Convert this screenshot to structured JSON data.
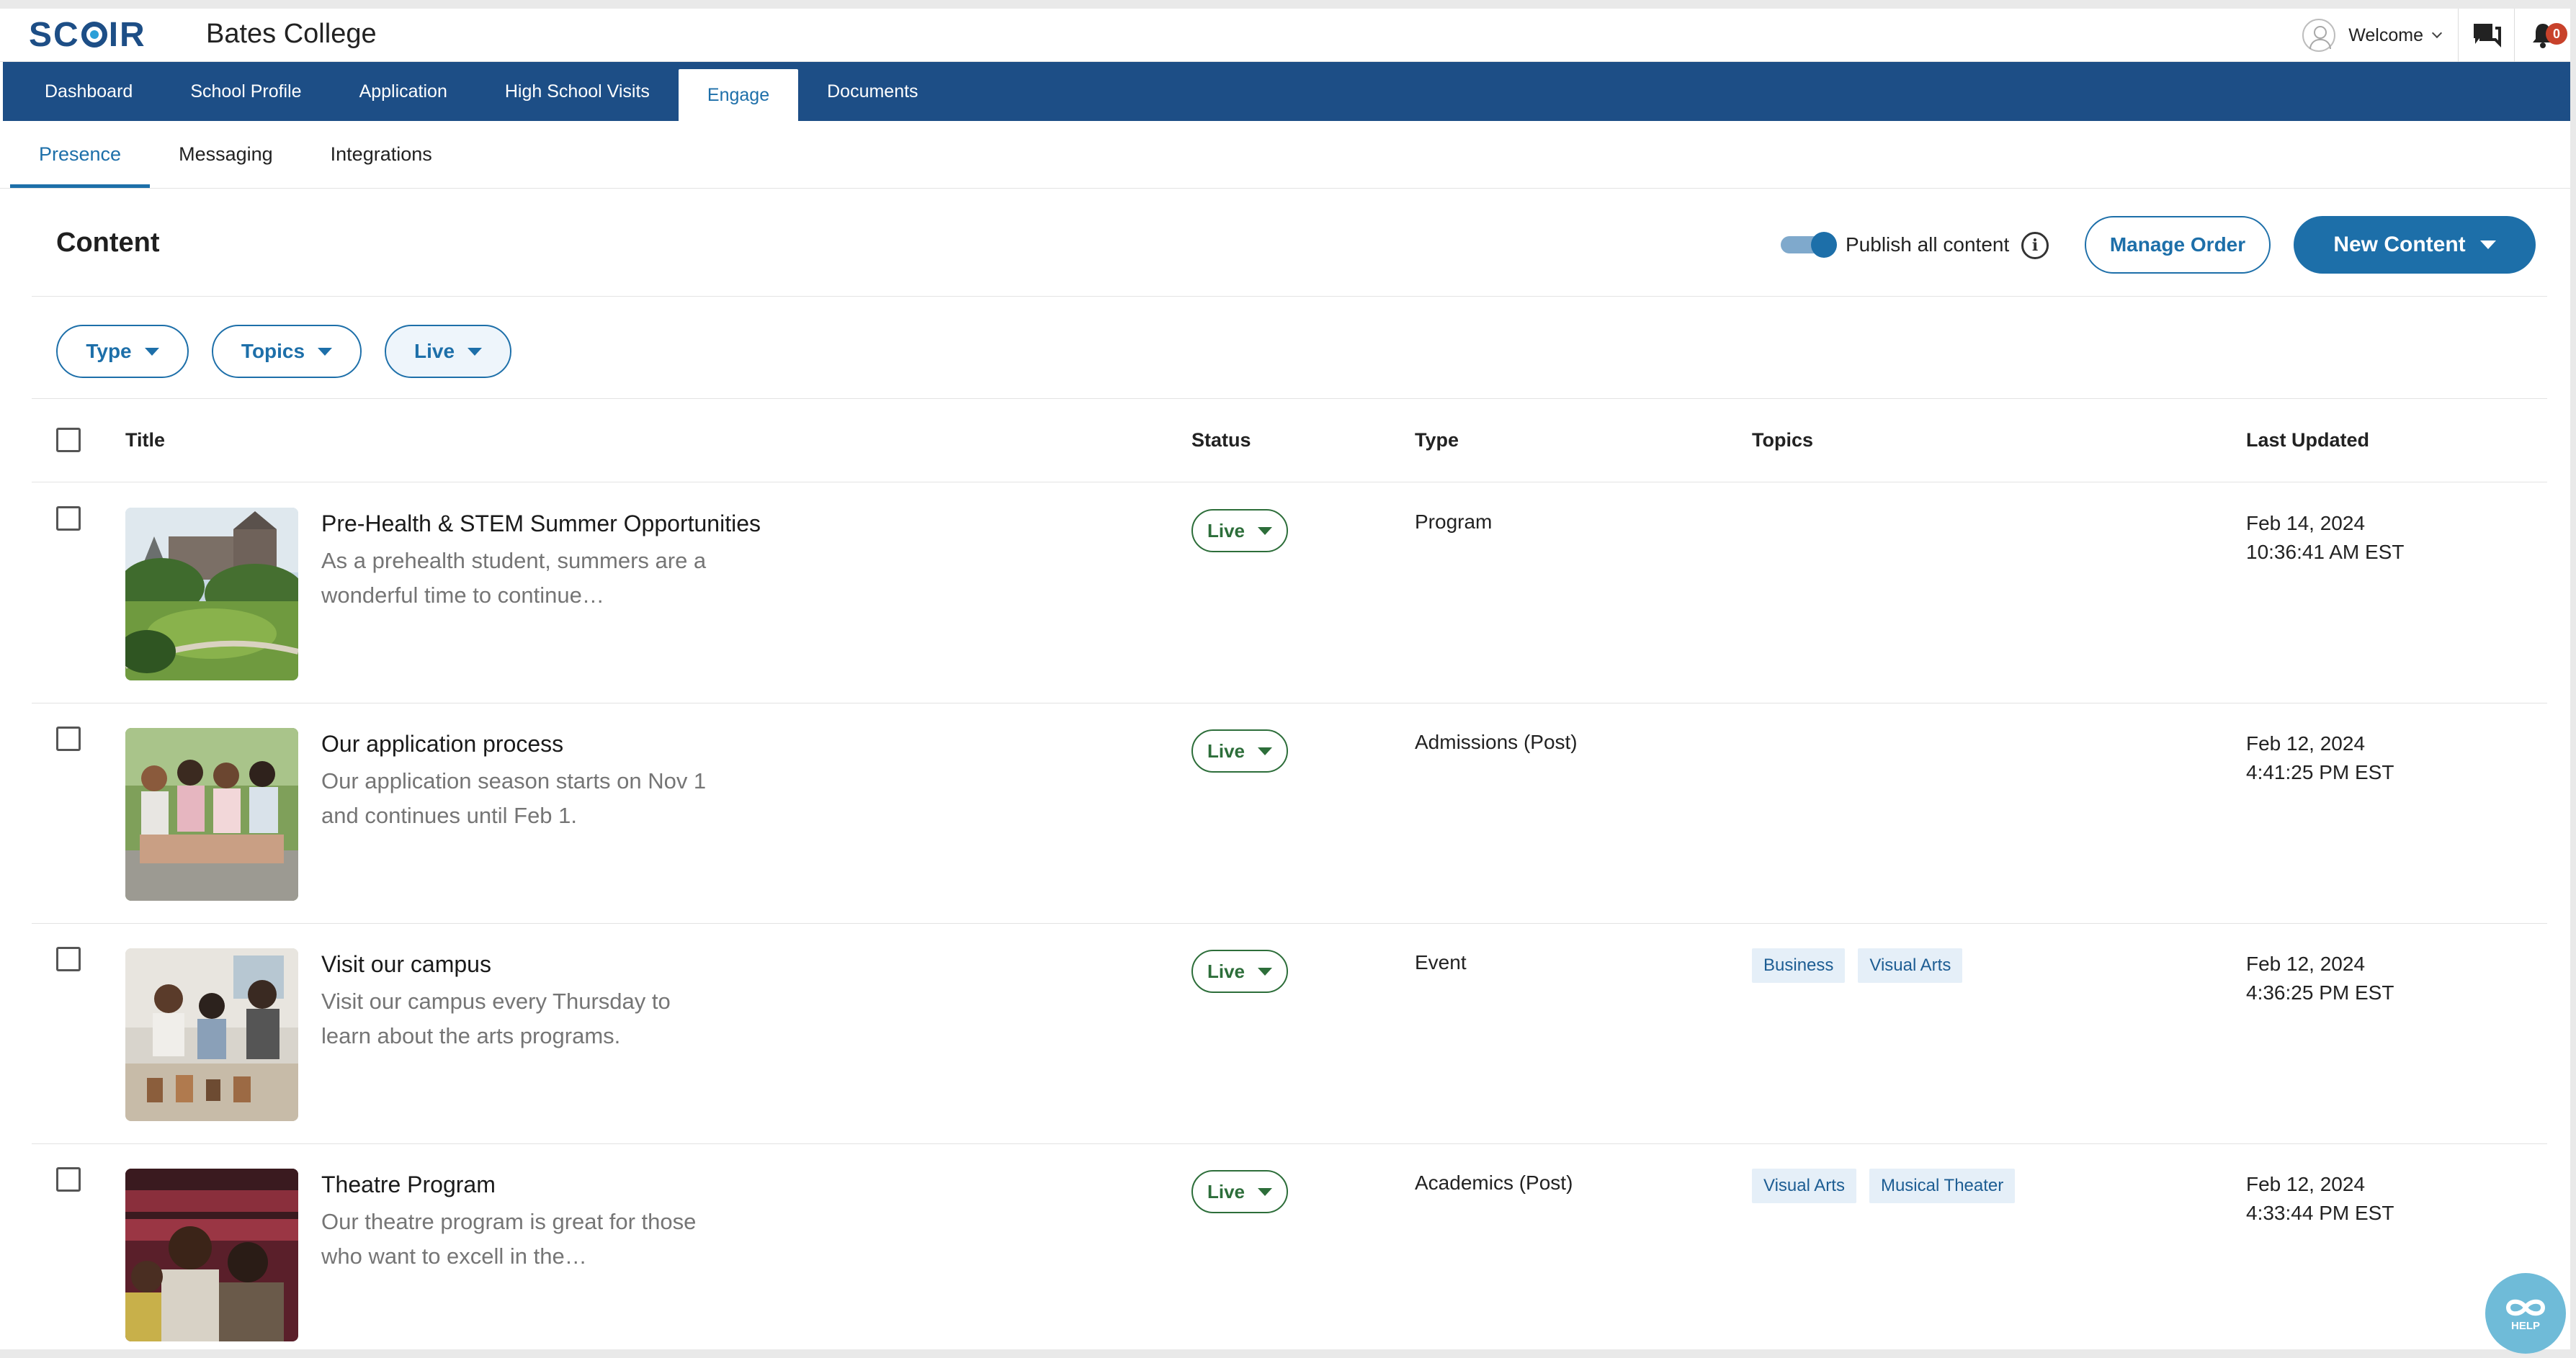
{
  "header": {
    "logo_text": "SCOIR",
    "college_name": "Bates College",
    "welcome_label": "Welcome",
    "notification_count": "0",
    "icons": [
      "avatar-icon",
      "chevron-down-icon",
      "chat-icon",
      "bell-icon"
    ]
  },
  "nav": {
    "items": [
      {
        "label": "Dashboard",
        "active": false
      },
      {
        "label": "School Profile",
        "active": false
      },
      {
        "label": "Application",
        "active": false
      },
      {
        "label": "High School Visits",
        "active": false
      },
      {
        "label": "Engage",
        "active": true
      },
      {
        "label": "Documents",
        "active": false
      }
    ]
  },
  "subnav": {
    "items": [
      {
        "label": "Presence",
        "active": true
      },
      {
        "label": "Messaging",
        "active": false
      },
      {
        "label": "Integrations",
        "active": false
      }
    ]
  },
  "content": {
    "title": "Content",
    "publish_all_label": "Publish all content",
    "publish_all_on": true,
    "manage_order_label": "Manage Order",
    "new_content_label": "New Content"
  },
  "filters": [
    {
      "label": "Type",
      "selected": false
    },
    {
      "label": "Topics",
      "selected": false
    },
    {
      "label": "Live",
      "selected": true
    }
  ],
  "table": {
    "columns": [
      "Title",
      "Status",
      "Type",
      "Topics",
      "Last Updated"
    ],
    "rows": [
      {
        "title": "Pre-Health & STEM Summer Opportunities",
        "description": "As a prehealth student, summers are a wonderful time to continue…",
        "status": "Live",
        "type": "Program",
        "topics": [],
        "updated_date": "Feb 14, 2024",
        "updated_time": "10:36:41 AM EST"
      },
      {
        "title": "Our application process",
        "description": "Our application season starts on Nov 1 and continues until Feb 1.",
        "status": "Live",
        "type": "Admissions (Post)",
        "topics": [],
        "updated_date": "Feb 12, 2024",
        "updated_time": "4:41:25 PM EST"
      },
      {
        "title": "Visit our campus",
        "description": "Visit our campus every Thursday to learn about the arts programs.",
        "status": "Live",
        "type": "Event",
        "topics": [
          "Business",
          "Visual Arts"
        ],
        "updated_date": "Feb 12, 2024",
        "updated_time": "4:36:25 PM EST"
      },
      {
        "title": "Theatre Program",
        "description": "Our theatre program is great for those who want to excell in the…",
        "status": "Live",
        "type": "Academics (Post)",
        "topics": [
          "Visual Arts",
          "Musical Theater"
        ],
        "updated_date": "Feb 12, 2024",
        "updated_time": "4:33:44 PM EST"
      }
    ]
  },
  "help_label": "HELP",
  "colors": {
    "brand_navy": "#1d4e86",
    "accent_blue": "#1d6fa9",
    "status_green": "#2d6e3a",
    "badge_red": "#c8422b"
  }
}
